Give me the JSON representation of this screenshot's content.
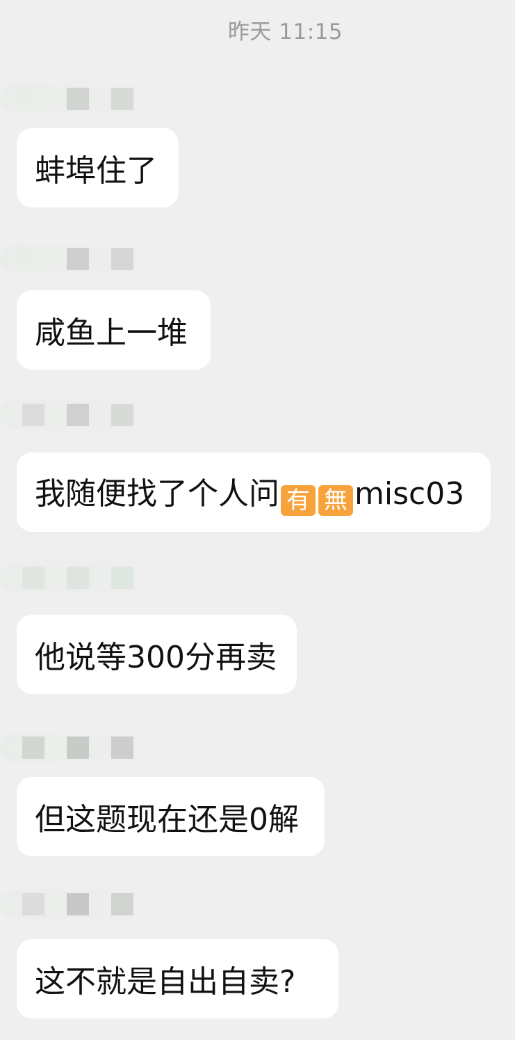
{
  "timestamp": "昨天 11:15",
  "messages": [
    {
      "text": "蚌埠住了"
    },
    {
      "text": "咸鱼上一堆"
    },
    {
      "text_before": "我随便找了个人问",
      "emoji1": "有",
      "emoji2": "無",
      "text_after": "misc03"
    },
    {
      "text": "他说等300分再卖"
    },
    {
      "text": "但这题现在还是0解"
    },
    {
      "text": "这不就是自出自卖?"
    }
  ],
  "colors": {
    "background": "#efefef",
    "bubble": "#ffffff",
    "timestamp": "#9a9a9a",
    "emoji_square": "#f7a23b"
  }
}
